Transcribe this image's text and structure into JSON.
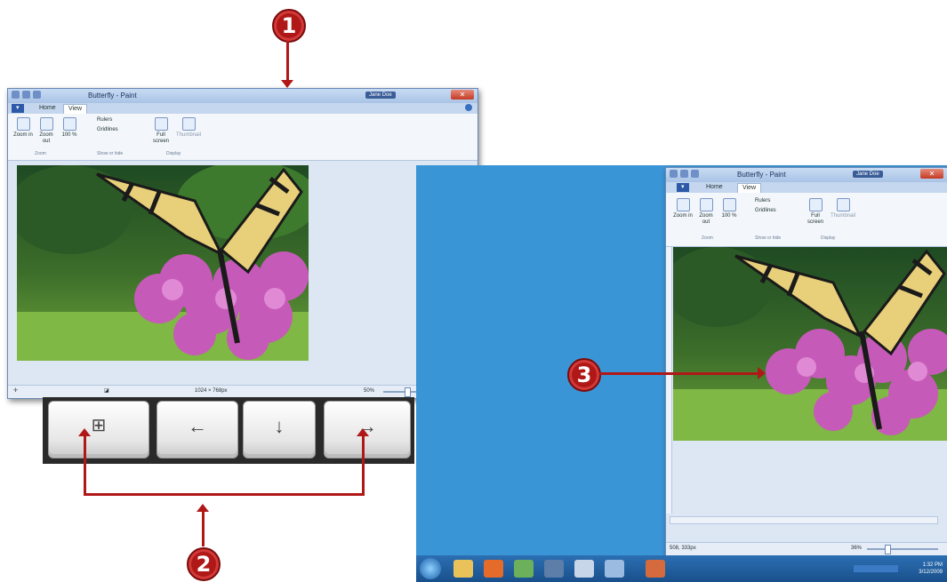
{
  "callouts": {
    "one": "1",
    "two": "2",
    "three": "3"
  },
  "window_left": {
    "title": "Butterfly - Paint",
    "user": "Jane Doe",
    "tabs": [
      "Home",
      "View"
    ],
    "ribbon_buttons": [
      "Zoom in",
      "Zoom out",
      "100 %"
    ],
    "show_items": [
      "Rulers",
      "Gridlines"
    ],
    "display_buttons": [
      "Full screen",
      "Thumbnail"
    ],
    "groups": [
      "Zoom",
      "Show or hide",
      "Display"
    ],
    "status_size": "1024 × 768px",
    "status_zoom": "50%"
  },
  "window_right": {
    "title": "Butterfly - Paint",
    "user": "Jane Doe",
    "tabs": [
      "Home",
      "View"
    ],
    "ribbon_buttons": [
      "Zoom in",
      "Zoom out",
      "100 %"
    ],
    "show_items": [
      "Rulers",
      "Gridlines"
    ],
    "display_buttons": [
      "Full screen",
      "Thumbnail"
    ],
    "groups": [
      "Zoom",
      "Show or hide",
      "Display"
    ],
    "status_coords": "508, 333px",
    "status_zoom": "36%"
  },
  "keys": [
    {
      "name": "windows-key",
      "glyph": "⊞"
    },
    {
      "name": "left-arrow-key",
      "glyph": "←"
    },
    {
      "name": "down-arrow-key",
      "glyph": "↓"
    },
    {
      "name": "right-arrow-key",
      "glyph": "→"
    }
  ],
  "taskbar": {
    "time": "1:32 PM",
    "date": "3/12/2009"
  },
  "colors": {
    "callout": "#b01818",
    "desktop": "#3a95d6",
    "file_tab": "#2d5aa8"
  }
}
